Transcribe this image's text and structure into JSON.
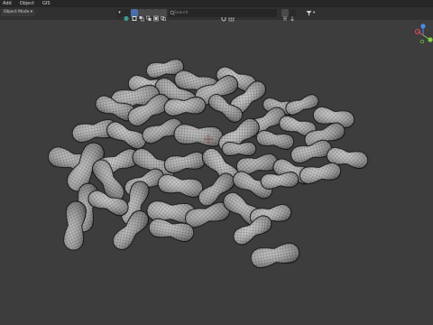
{
  "menu": {
    "items": [
      "Add",
      "Object",
      "GIS"
    ]
  },
  "header": {
    "mode_label": "Object Mode",
    "transform_orientation": "Global",
    "search_placeholder": "Search"
  },
  "gizmo": {
    "colors": {
      "x": "#e84a5f",
      "y": "#7ecb4b",
      "z": "#4a8be8"
    }
  },
  "theme": {
    "viewport_bg": "#3d3d3d",
    "header_bg": "#303030",
    "accent": "#4a6fa8"
  }
}
